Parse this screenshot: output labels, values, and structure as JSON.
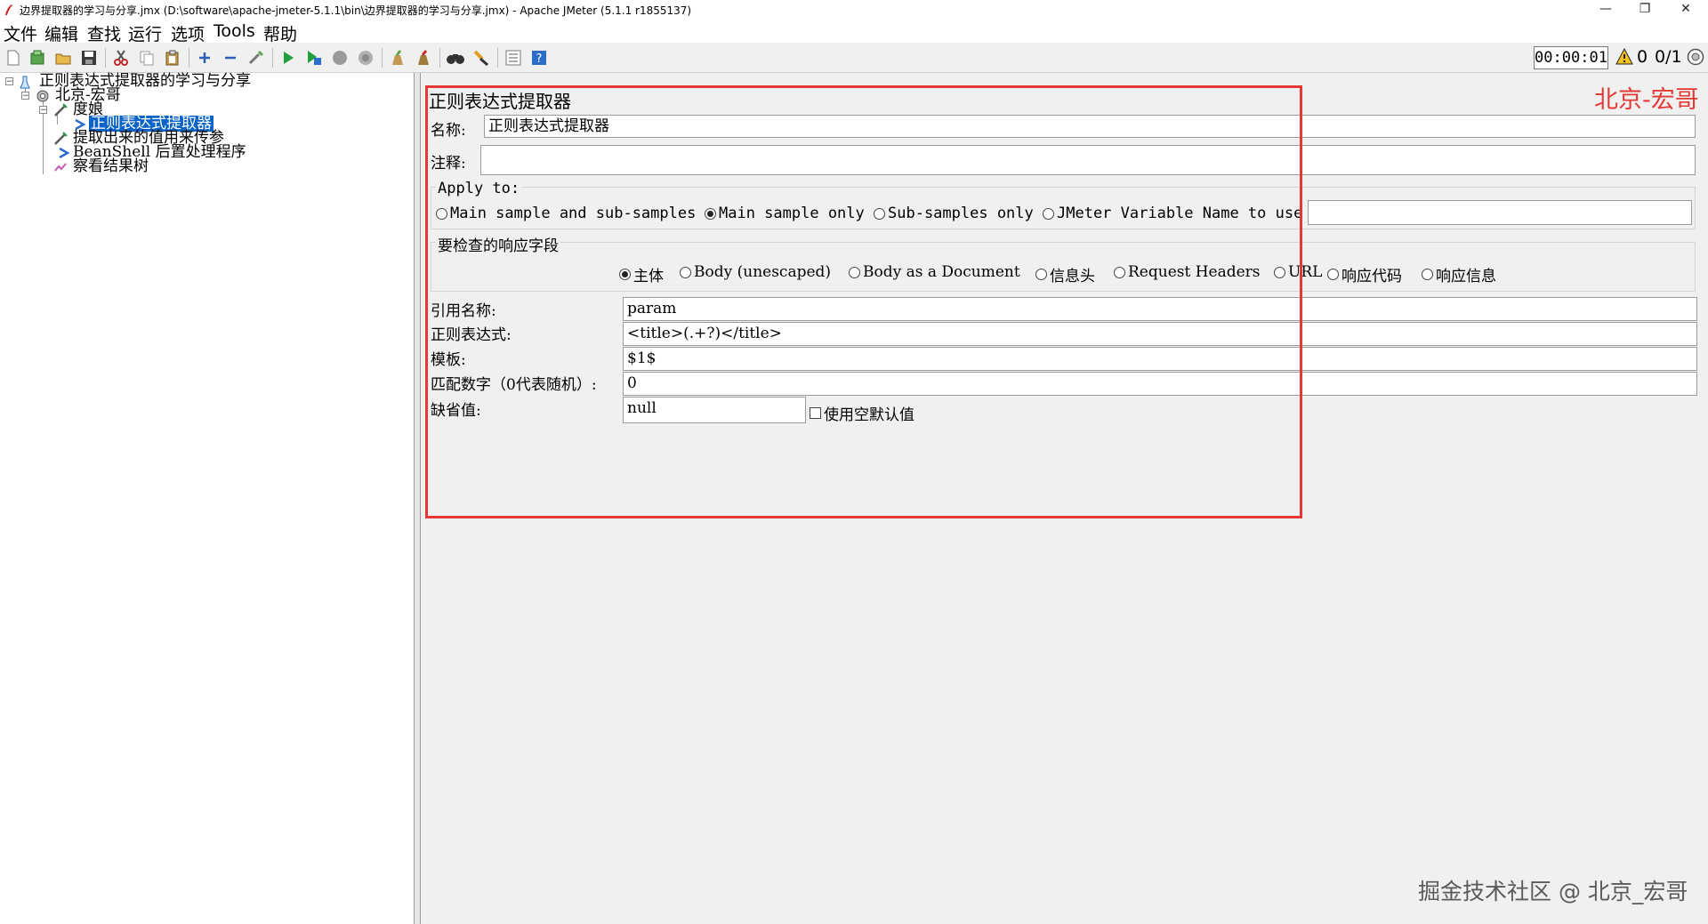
{
  "window": {
    "title": "边界提取器的学习与分享.jmx (D:\\software\\apache-jmeter-5.1.1\\bin\\边界提取器的学习与分享.jmx) - Apache JMeter (5.1.1 r1855137)",
    "minimize": "—",
    "restore": "❐",
    "close": "✕"
  },
  "menu": [
    "文件",
    "编辑",
    "查找",
    "运行",
    "选项",
    "Tools",
    "帮助"
  ],
  "status": {
    "timer": "00:00:01",
    "warning_count": "0",
    "threads": "0/1"
  },
  "tree": {
    "root": "正则表达式提取器的学习与分享",
    "thread_group": "北京-宏哥",
    "sampler": "度娘",
    "extractor": "正则表达式提取器",
    "sampler2": "提取出来的值用来传参",
    "postprocessor": "BeanShell 后置处理程序",
    "listener": "察看结果树"
  },
  "panel": {
    "title": "正则表达式提取器",
    "name_label": "名称:",
    "name_value": "正则表达式提取器",
    "comment_label": "注释:",
    "comment_value": "",
    "apply_to_label": "Apply to:",
    "apply_options": [
      "Main sample and sub-samples",
      "Main sample only",
      "Sub-samples only",
      "JMeter Variable Name to use"
    ],
    "jmeter_var_value": "",
    "check_field_label": "要检查的响应字段",
    "field_options": [
      "主体",
      "Body (unescaped)",
      "Body as a Document",
      "信息头",
      "Request Headers",
      "URL",
      "响应代码",
      "响应信息"
    ],
    "ref_name_label": "引用名称:",
    "ref_name_value": "param",
    "regex_label": "正则表达式:",
    "regex_value": "<title>(.+?)</title>",
    "template_label": "模板:",
    "template_value": "$1$",
    "match_no_label": "匹配数字（0代表随机）:",
    "match_no_value": "0",
    "default_label": "缺省值:",
    "default_value": "null",
    "use_empty_default": "使用空默认值"
  },
  "watermarks": {
    "top_right": "北京-宏哥",
    "bottom_right": "掘金技术社区 @ 北京_宏哥"
  },
  "colors": {
    "highlight": "#e53935",
    "selection": "#0a64c8"
  }
}
